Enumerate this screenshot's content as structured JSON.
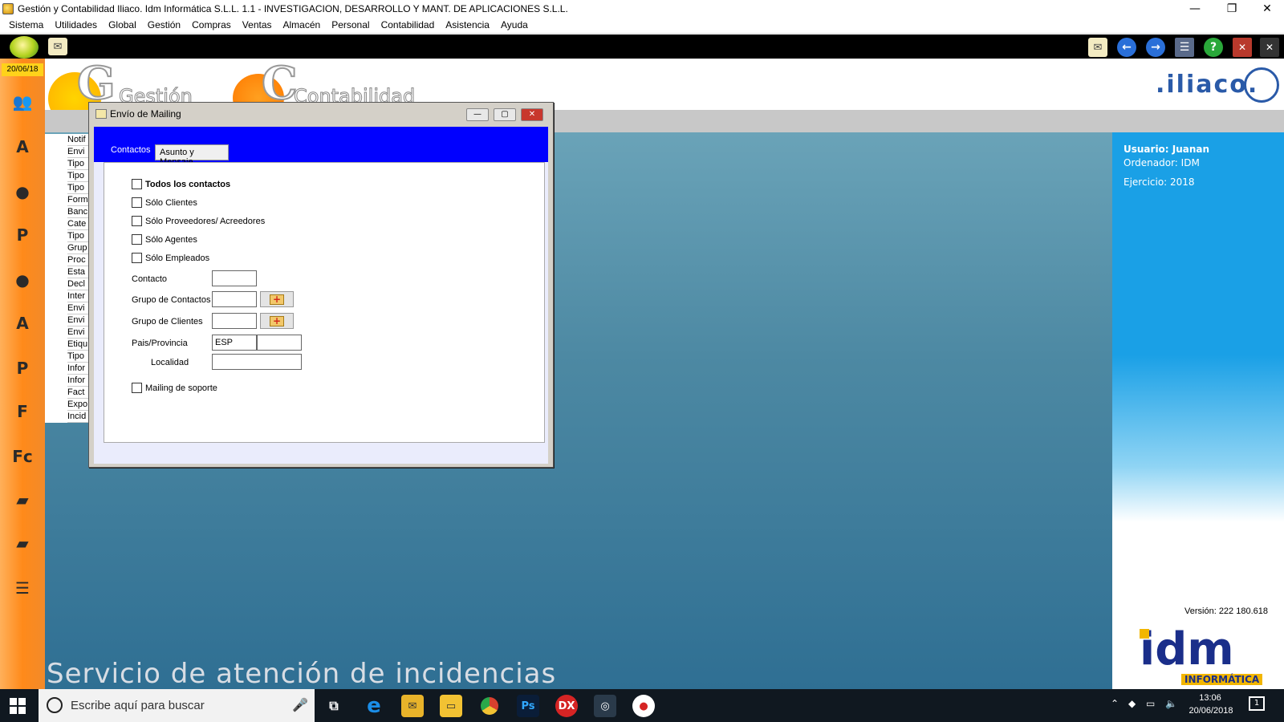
{
  "window": {
    "title": "Gestión y Contabilidad Iliaco. Idm Informática S.L.L. 1.1 - INVESTIGACION, DESARROLLO Y MANT. DE APLICACIONES S.L.L.",
    "minimize_glyph": "—",
    "restore_glyph": "❐",
    "close_glyph": "✕"
  },
  "menu": [
    "Sistema",
    "Utilidades",
    "Global",
    "Gestión",
    "Compras",
    "Ventas",
    "Almacén",
    "Personal",
    "Contabilidad",
    "Asistencia",
    "Ayuda"
  ],
  "sidebar": {
    "date": "20/06/18",
    "icons": [
      "contacts-group-icon",
      "agenda-icon",
      "client-icon",
      "provider-icon",
      "agents-icon",
      "employee-icon",
      "presupuesto-icon",
      "factura-icon",
      "factura-compra-icon",
      "bag-green-icon",
      "bag-orange-icon",
      "notebook-icon"
    ]
  },
  "header": {
    "logo_gestion": "Gestión",
    "logo_contabilidad": "Contabilidad",
    "brand": ".iliaco."
  },
  "left_list": [
    "Notif",
    "Envi",
    "Tipo",
    "Tipo",
    "Tipo",
    "Form",
    "Banc",
    "Cate",
    "Tipo",
    "Grup",
    "Proc",
    "Esta",
    "Decl",
    "Inter",
    "Envi",
    "Envi",
    "Envi",
    "Etiqu",
    "Tipo",
    "Infor",
    "Infor",
    "Fact",
    "Expo",
    "Incid"
  ],
  "dialog": {
    "title": "Envío de Mailing",
    "tabs": [
      "Contactos",
      "Asunto y Mensaje"
    ],
    "checkboxes": {
      "todos": "Todos los contactos",
      "clientes": "Sólo Clientes",
      "proveedores": "Sólo Proveedores/ Acreedores",
      "agentes": "Sólo Agentes",
      "empleados": "Sólo Empleados",
      "soporte": "Mailing de soporte"
    },
    "fields": {
      "contacto_label": "Contacto",
      "contacto_value": "",
      "grupo_contactos_label": "Grupo de Contactos",
      "grupo_contactos_value": "",
      "grupo_clientes_label": "Grupo de Clientes",
      "grupo_clientes_value": "",
      "pais_label": "Pais/Provincia",
      "pais_value": "ESP",
      "provincia_value": "",
      "localidad_label": "Localidad",
      "localidad_value": ""
    }
  },
  "right_panel": {
    "usuario": "Usuario: Juanan",
    "ordenador": "Ordenador: IDM",
    "ejercicio": "Ejercicio: 2018",
    "version": "Versión: 222 180.618",
    "company": "idm",
    "company_sub": "INFORMÁTICA"
  },
  "footer_text": "Servicio de atención de incidencias",
  "taskbar": {
    "search_placeholder": "Escribe aquí para buscar",
    "time": "13:06",
    "date": "20/06/2018",
    "notification_count": "1",
    "apps": [
      {
        "name": "task-view-icon",
        "color": "#101820",
        "label": "⧉"
      },
      {
        "name": "edge-icon",
        "color": "#1b6fd6",
        "label": "e"
      },
      {
        "name": "mail-folder-icon",
        "color": "#e8b32a",
        "label": "✉"
      },
      {
        "name": "file-explorer-icon",
        "color": "#f2c233",
        "label": "▭"
      },
      {
        "name": "chrome-icon",
        "color": "#d8402e",
        "label": "◉"
      },
      {
        "name": "photoshop-icon",
        "color": "#0a1d38",
        "label": "Ps"
      },
      {
        "name": "dx-icon",
        "color": "#d52424",
        "label": "DX"
      },
      {
        "name": "iliaco-app-icon",
        "color": "#4a6a8a",
        "label": "◎"
      },
      {
        "name": "fire-app-icon",
        "color": "#f0f0f0",
        "label": "●"
      }
    ]
  }
}
